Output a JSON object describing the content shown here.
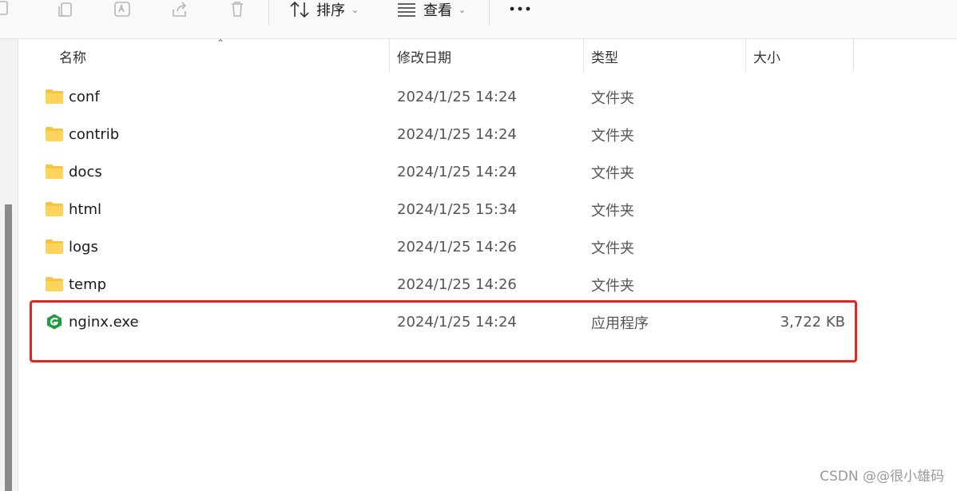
{
  "toolbar": {
    "sort_label": "排序",
    "view_label": "查看"
  },
  "header": {
    "name": "名称",
    "modified": "修改日期",
    "type": "类型",
    "size": "大小"
  },
  "files": [
    {
      "name": "conf",
      "modified": "2024/1/25 14:24",
      "type": "文件夹",
      "size": "",
      "icon": "folder-icon"
    },
    {
      "name": "contrib",
      "modified": "2024/1/25 14:24",
      "type": "文件夹",
      "size": "",
      "icon": "folder-icon"
    },
    {
      "name": "docs",
      "modified": "2024/1/25 14:24",
      "type": "文件夹",
      "size": "",
      "icon": "folder-icon"
    },
    {
      "name": "html",
      "modified": "2024/1/25 15:34",
      "type": "文件夹",
      "size": "",
      "icon": "folder-icon"
    },
    {
      "name": "logs",
      "modified": "2024/1/25 14:26",
      "type": "文件夹",
      "size": "",
      "icon": "folder-icon"
    },
    {
      "name": "temp",
      "modified": "2024/1/25 14:26",
      "type": "文件夹",
      "size": "",
      "icon": "folder-icon"
    },
    {
      "name": "nginx.exe",
      "modified": "2024/1/25 14:24",
      "type": "应用程序",
      "size": "3,722 KB",
      "icon": "nginx-app-icon"
    }
  ],
  "watermark": "CSDN @@很小雄码",
  "colors": {
    "highlight": "#e8231d",
    "folder": "#f6c343",
    "nginx": "#1a9c3a"
  }
}
